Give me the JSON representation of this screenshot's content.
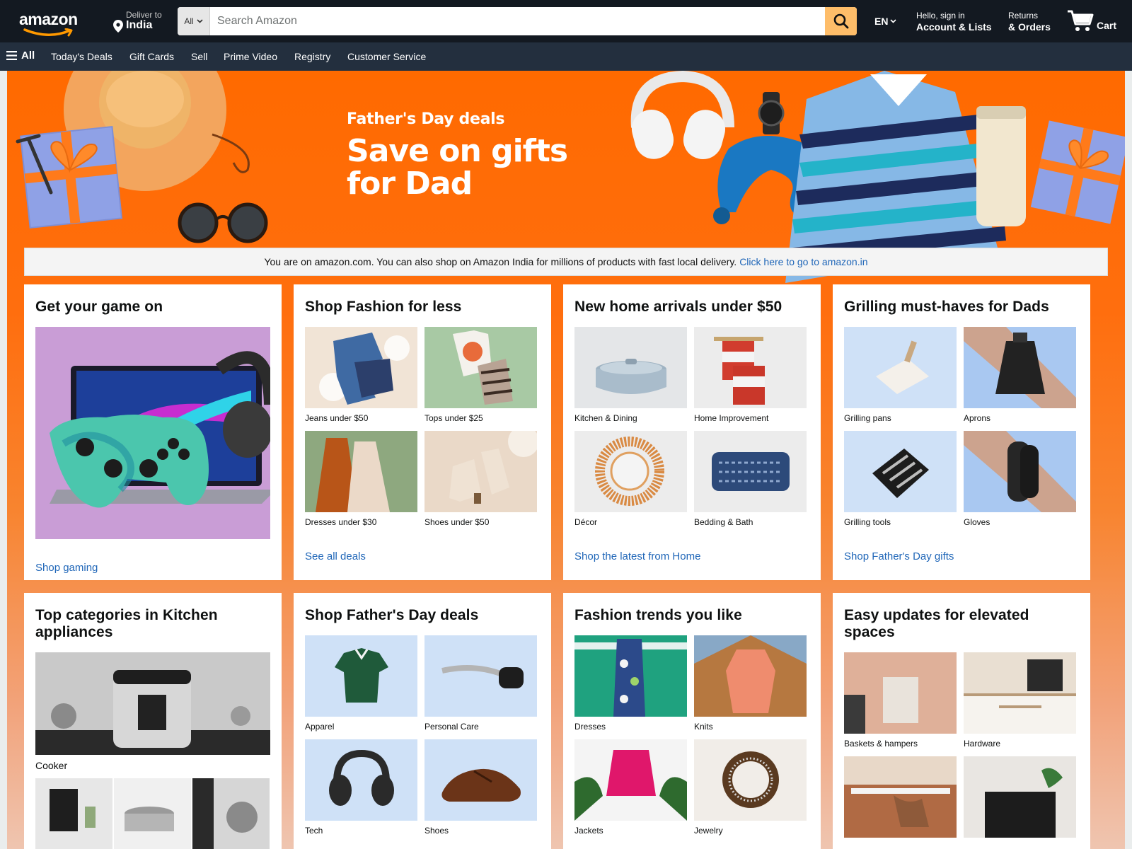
{
  "header": {
    "logo_text": "amazon",
    "deliver_small": "Deliver to",
    "deliver_big": "India",
    "search_category": "All",
    "search_placeholder": "Search Amazon",
    "language": "EN",
    "account_small": "Hello, sign in",
    "account_big": "Account & Lists",
    "orders_small": "Returns",
    "orders_big": "& Orders",
    "cart_label": "Cart"
  },
  "nav": {
    "all": "All",
    "items": [
      "Today's Deals",
      "Gift Cards",
      "Sell",
      "Prime Video",
      "Registry",
      "Customer Service"
    ]
  },
  "hero": {
    "subtitle": "Father's Day deals",
    "title": "Save on gifts for Dad"
  },
  "notice": {
    "text": "You are on amazon.com. You can also shop on Amazon India for millions of products with fast local delivery.",
    "link": "Click here to go to amazon.in"
  },
  "cards": [
    {
      "title": "Get your game on",
      "link": "Shop gaming"
    },
    {
      "title": "Shop Fashion for less",
      "tiles": [
        "Jeans under $50",
        "Tops under $25",
        "Dresses under $30",
        "Shoes under $50"
      ],
      "link": "See all deals"
    },
    {
      "title": "New home arrivals under $50",
      "tiles": [
        "Kitchen & Dining",
        "Home Improvement",
        "Décor",
        "Bedding & Bath"
      ],
      "link": "Shop the latest from Home"
    },
    {
      "title": "Grilling must-haves for Dads",
      "tiles": [
        "Grilling pans",
        "Aprons",
        "Grilling tools",
        "Gloves"
      ],
      "link": "Shop Father's Day gifts"
    },
    {
      "title": "Top categories in Kitchen appliances",
      "tiles": [
        "Cooker"
      ]
    },
    {
      "title": "Shop Father's Day deals",
      "tiles": [
        "Apparel",
        "Personal Care",
        "Tech",
        "Shoes"
      ]
    },
    {
      "title": "Fashion trends you like",
      "tiles": [
        "Dresses",
        "Knits",
        "Jackets",
        "Jewelry"
      ]
    },
    {
      "title": "Easy updates for elevated spaces",
      "tiles": [
        "Baskets & hampers",
        "Hardware"
      ]
    }
  ],
  "colors": {
    "header_bg": "#131921",
    "nav_bg": "#232f3e",
    "search_button": "#febd69",
    "hero_orange": "#ff6a00",
    "link": "#1f66b8"
  }
}
